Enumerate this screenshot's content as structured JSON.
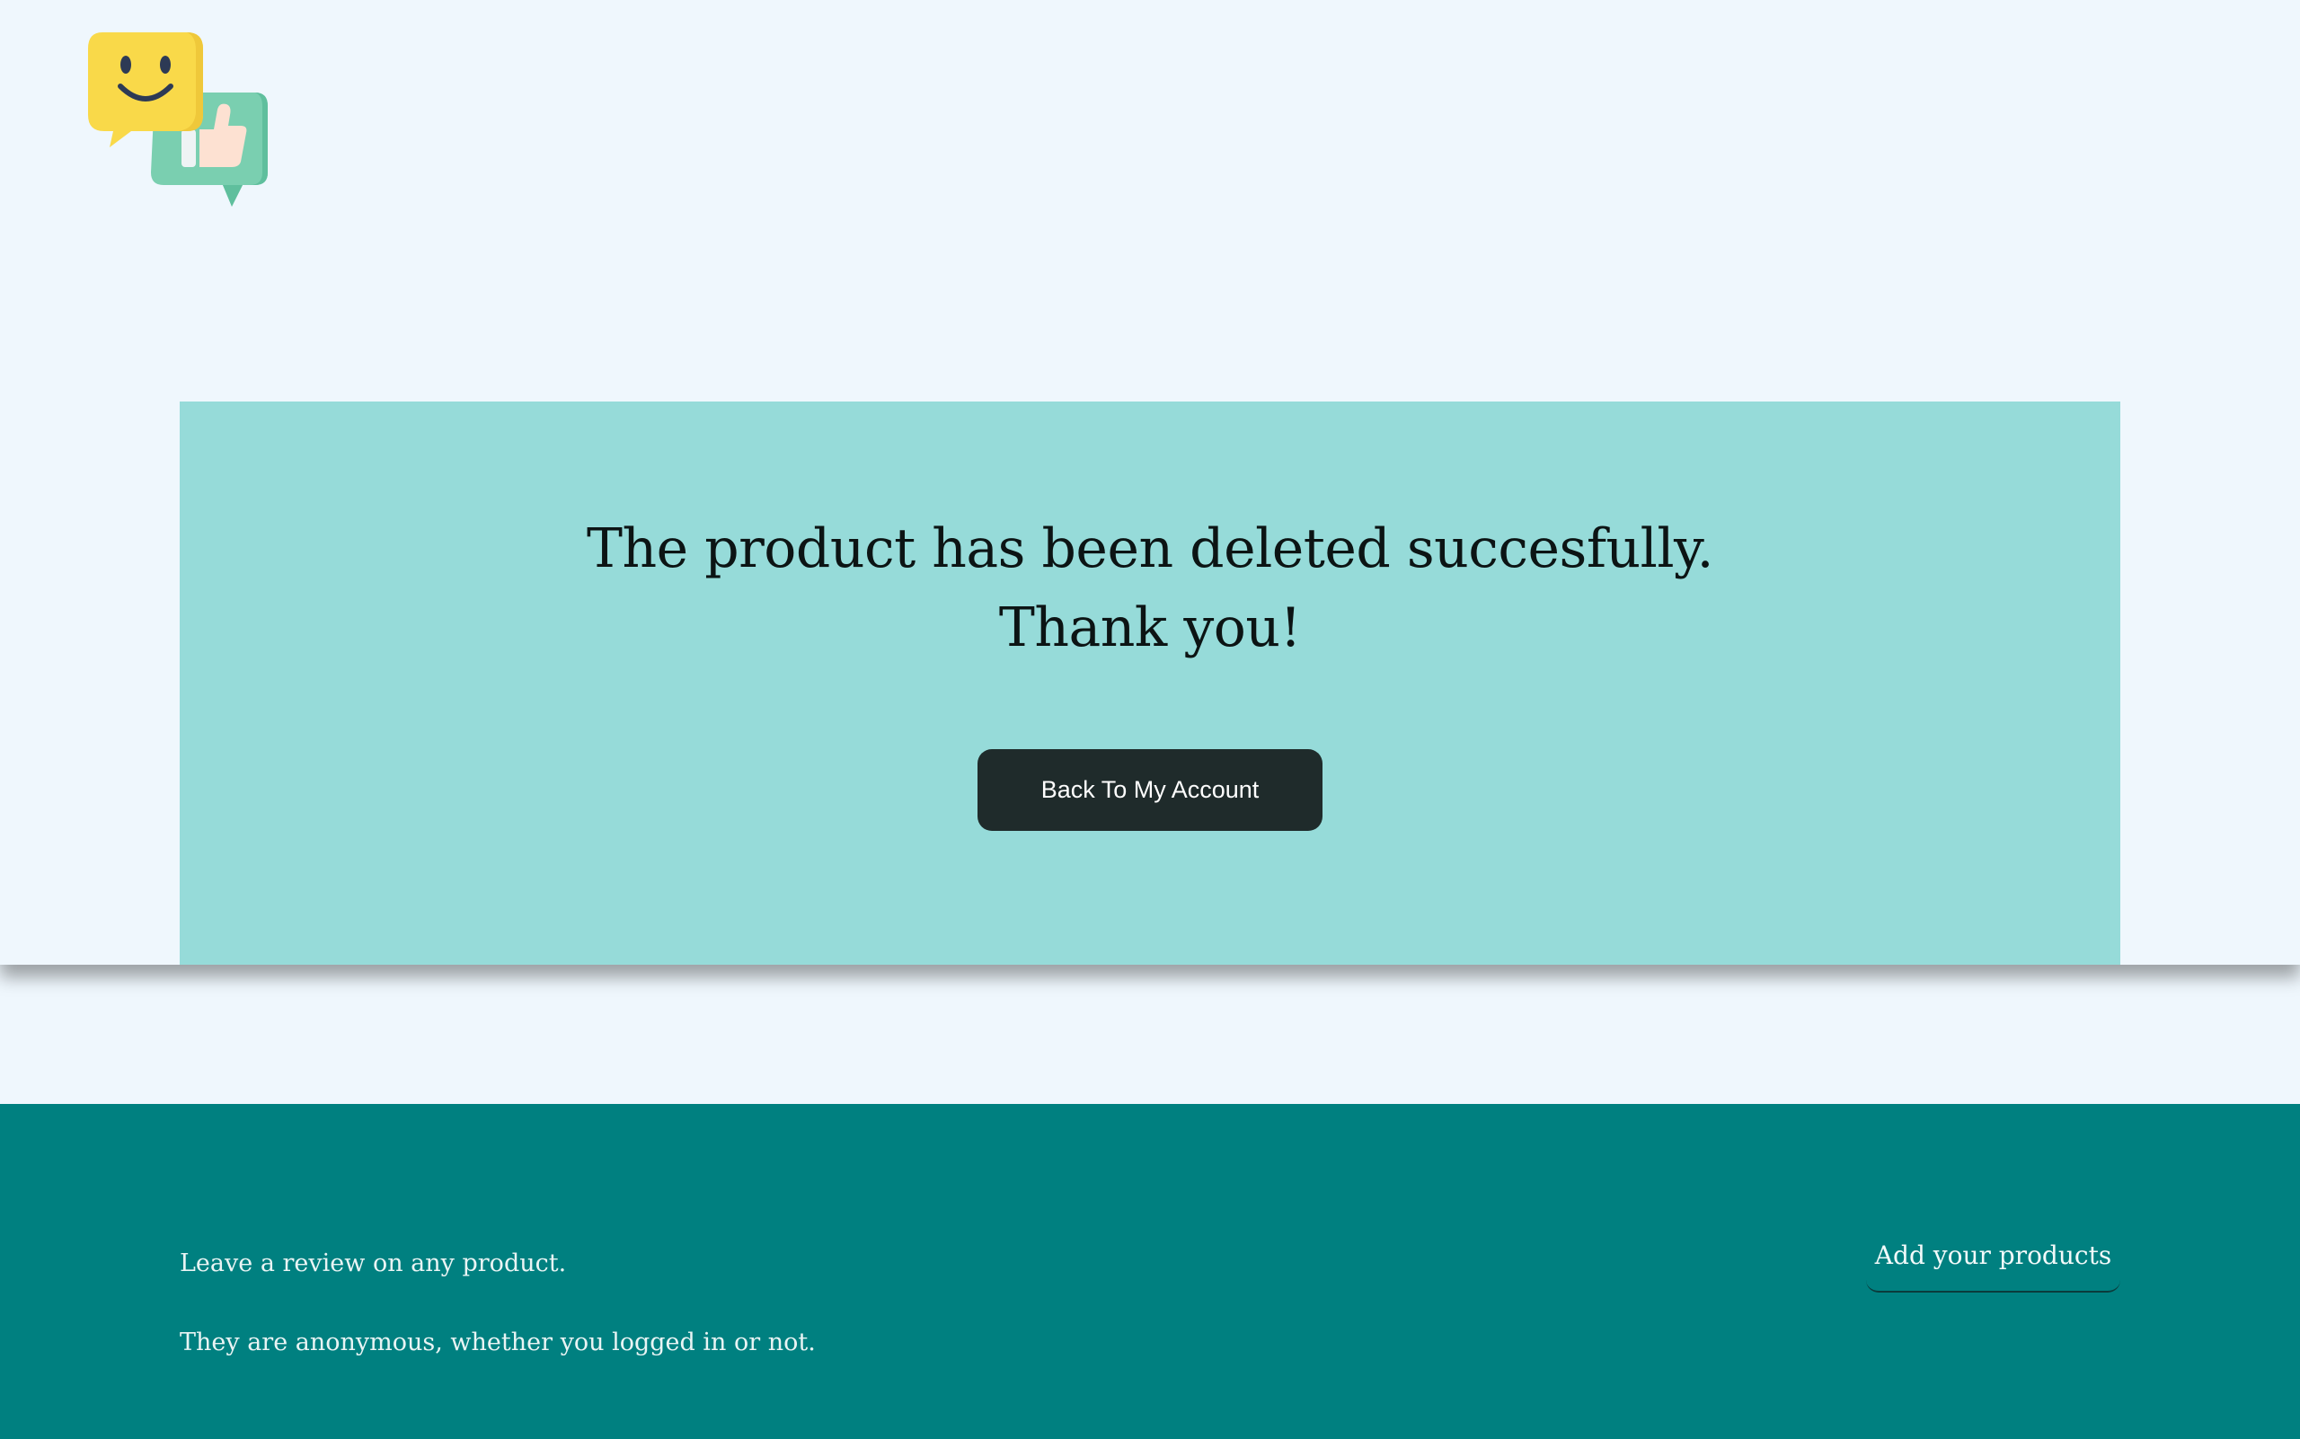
{
  "header": {
    "logo_icon": "chat-smiley-thumbs-up-logo"
  },
  "confirmation": {
    "line1": "The product has been deleted succesfully.",
    "line2": "Thank you!",
    "back_button_label": "Back To My Account"
  },
  "footer": {
    "line1": "Leave a review on any product.",
    "line2": "They are anonymous, whether you logged in or not.",
    "add_products_label": "Add your products"
  },
  "colors": {
    "page_background": "#eff7fd",
    "card_background": "#96dbd9",
    "button_background": "#1f2b2b",
    "footer_background": "#008080"
  }
}
